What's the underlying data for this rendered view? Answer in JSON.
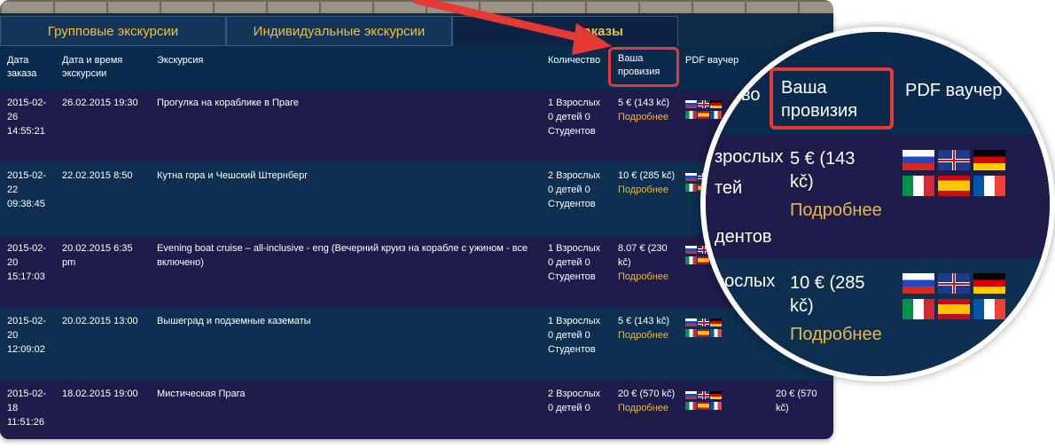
{
  "tabs": [
    {
      "label": "Групповые экскурсии"
    },
    {
      "label": "Индивидуальные экскурсии"
    },
    {
      "label": "заказы"
    }
  ],
  "columns": {
    "order_date": "Дата заказа",
    "datetime": "Дата и время экскурсии",
    "excursion": "Экскурсия",
    "quantity": "Количество",
    "commission": "Ваша провизия",
    "pdf": "PDF ваучер"
  },
  "more_label": "Подробнее",
  "rows": [
    {
      "order_date": "2015-02-26 14:55:21",
      "datetime": "26.02.2015 19:30",
      "excursion": "Прогулка на кораблике в Праге",
      "quantity": "1 Взрослых 0 детей 0 Студентов",
      "commission": "5 € (143 kč)",
      "extra": ""
    },
    {
      "order_date": "2015-02-22 09:38:45",
      "datetime": "22.02.2015 8:50",
      "excursion": "Кутна гора и Чешский Штернберг",
      "quantity": "2 Взрослых 0 детей 0 Студентов",
      "commission": "10 € (285 kč)",
      "extra": ""
    },
    {
      "order_date": "2015-02-20 15:17:03",
      "datetime": "20.02.2015 6:35 pm",
      "excursion": "Evening boat cruise – all-inclusive - eng (Вечерний круиз на корабле с ужином - все включено)",
      "quantity": "1 Взрослых 0 детей 0 Студентов",
      "commission": "8.07 € (230 kč)",
      "extra": ""
    },
    {
      "order_date": "2015-02-20 12:09:02",
      "datetime": "20.02.2015 13:00",
      "excursion": "Вышеград и подземные казематы",
      "quantity": "1 Взрослых 0 детей 0 Студентов",
      "commission": "5 € (143 kč)",
      "extra": ""
    },
    {
      "order_date": "2015-02-18 11:51:26",
      "datetime": "18.02.2015 19:00",
      "excursion": "Мистическая Прага",
      "quantity": "2 Взрослых 0 детей 0",
      "commission": "20 € (570 kč)",
      "extra": "20 € (570 kč)"
    }
  ],
  "magnifier": {
    "header_commission": "Ваша провизия",
    "header_pdf": "PDF ваучер",
    "row1_commission": "5 € (143 kč)",
    "row2_commission": "10 € (285 kč)",
    "partial_vzroslyh": "зрослых",
    "partial_detey": "тей",
    "partial_students": "дентов",
    "partial_vzroslyh2": "рослых",
    "partial_header": "во"
  },
  "flags": [
    "ru-flag-icon",
    "gb-flag-icon",
    "de-flag-icon",
    "it-flag-icon",
    "es-flag-icon",
    "fr-flag-icon"
  ],
  "colors": {
    "highlight": "#e53935",
    "link": "#e8b84a",
    "tab_text": "#f0c040",
    "header_bg": "#0b2b4e",
    "row_dark": "#1e1c4a",
    "row_blue": "#0e2f4f"
  }
}
